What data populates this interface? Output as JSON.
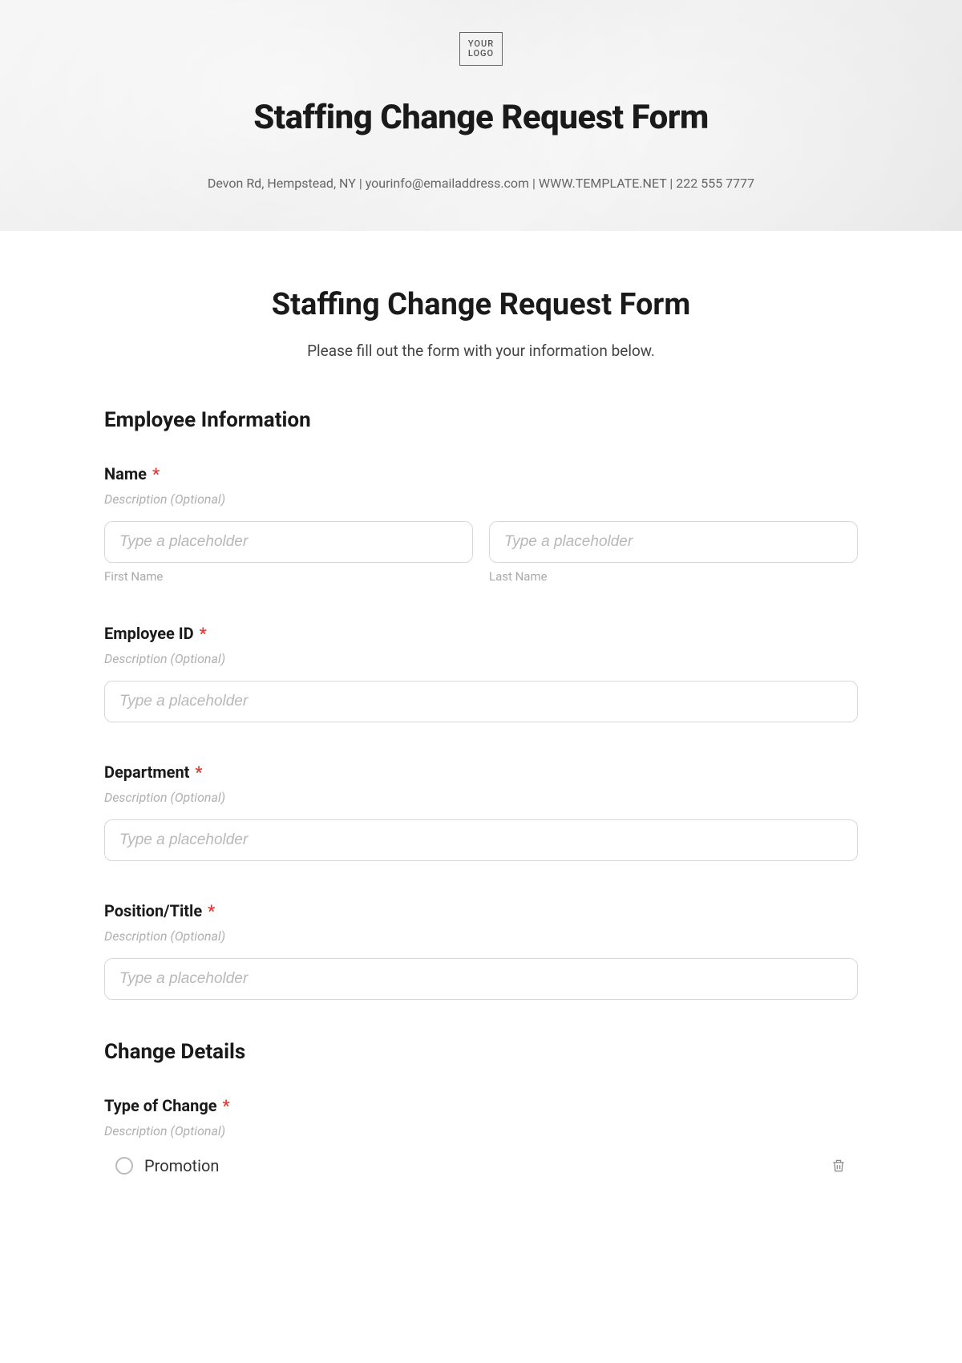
{
  "hero": {
    "logo_line1": "YOUR",
    "logo_line2": "LOGO",
    "title": "Staffing Change Request Form",
    "meta": "Devon Rd, Hempstead, NY | yourinfo@emailaddress.com | WWW.TEMPLATE.NET | 222 555 7777"
  },
  "form": {
    "title": "Staffing Change Request Form",
    "subtitle": "Please fill out the form with your information below."
  },
  "sections": {
    "employee_info": "Employee Information",
    "change_details": "Change Details"
  },
  "fields": {
    "name": {
      "label": "Name",
      "description": "Description (Optional)",
      "first_placeholder": "Type a placeholder",
      "first_sublabel": "First Name",
      "last_placeholder": "Type a placeholder",
      "last_sublabel": "Last Name"
    },
    "employee_id": {
      "label": "Employee ID",
      "description": "Description (Optional)",
      "placeholder": "Type a placeholder"
    },
    "department": {
      "label": "Department",
      "description": "Description (Optional)",
      "placeholder": "Type a placeholder"
    },
    "position": {
      "label": "Position/Title",
      "description": "Description (Optional)",
      "placeholder": "Type a placeholder"
    },
    "type_of_change": {
      "label": "Type of Change",
      "description": "Description (Optional)",
      "options": [
        "Promotion"
      ]
    }
  },
  "asterisk": "*"
}
